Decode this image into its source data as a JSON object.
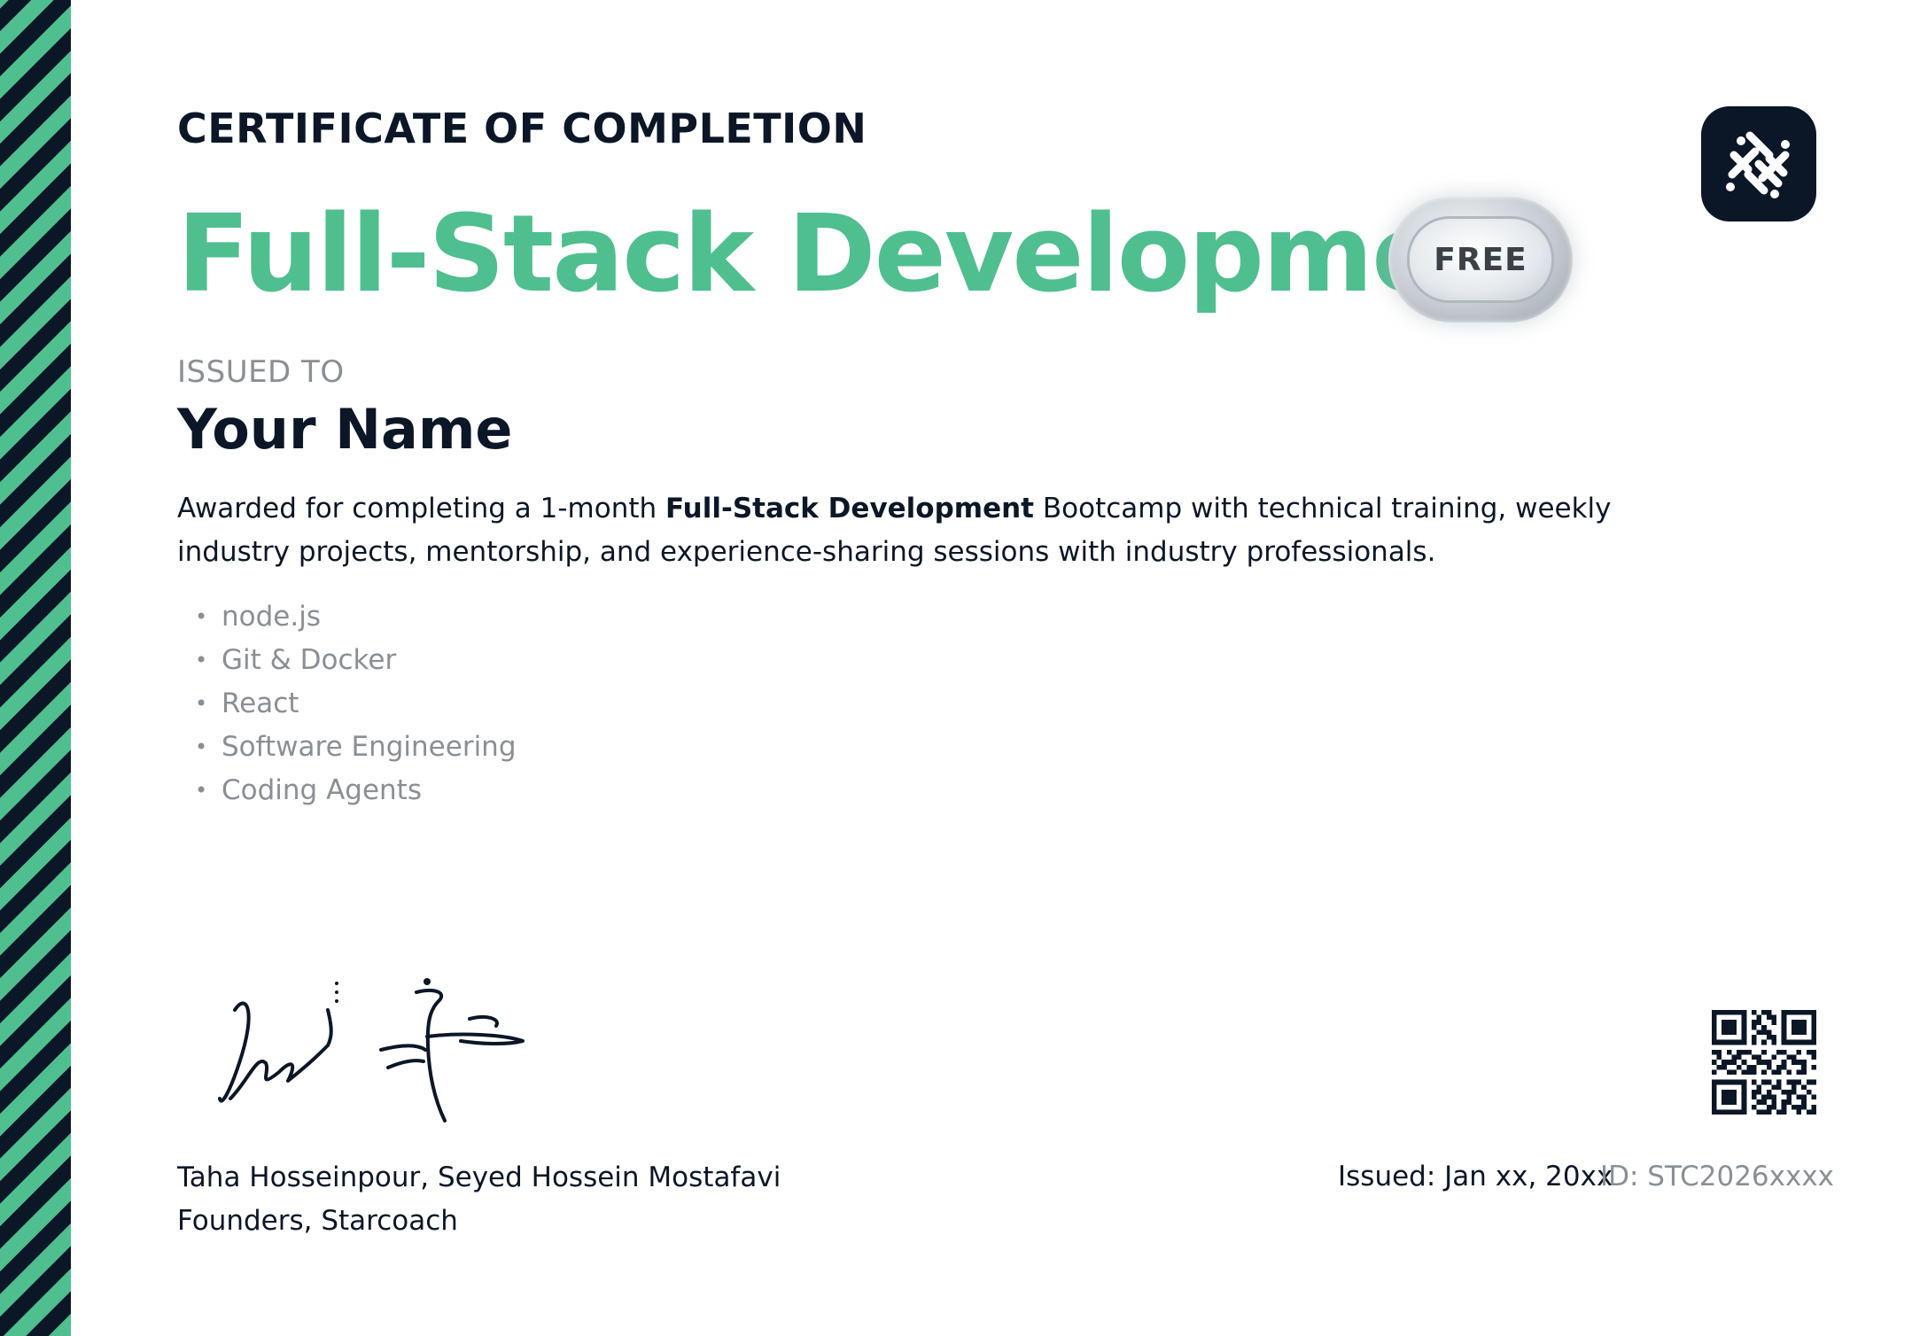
{
  "certificate": {
    "heading": "CERTIFICATE OF COMPLETION",
    "course_title": "Full-Stack Development",
    "badge_label": "FREE",
    "issued_to_label": "ISSUED TO",
    "recipient_name": "Your Name",
    "description": {
      "prefix": "Awarded for completing a 1-month ",
      "bold": "Full-Stack Development",
      "suffix": " Bootcamp with technical training, weekly industry projects, mentorship, and experience-sharing sessions with industry professionals."
    },
    "skills": [
      "node.js",
      "Git & Docker",
      "React",
      "Software Engineering",
      "Coding Agents"
    ],
    "founders": {
      "names": "Taha Hosseinpour, Seyed Hossein Mostafavi",
      "role": "Founders, Starcoach"
    },
    "issued_date": "Issued: Jan xx, 20xx",
    "cert_id": "ID: STC2026xxxx"
  },
  "colors": {
    "accent": "#4fbf8f",
    "dark": "#0b1727",
    "muted": "#8a8f96"
  },
  "icons": {
    "logo": "starcoach-logo-icon",
    "qr": "qr-code-icon",
    "signatures": "handwritten-signatures"
  }
}
